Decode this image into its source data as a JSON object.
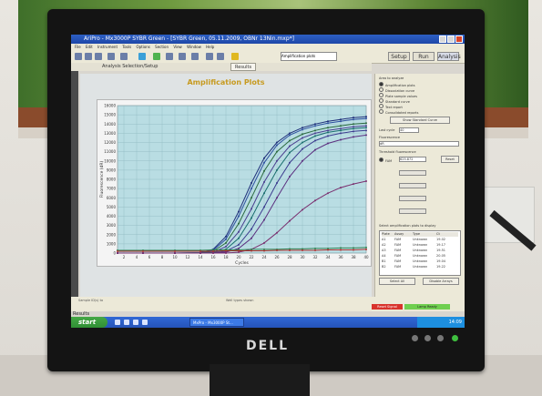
{
  "window": {
    "title": "AriPro - Mx3000P SYBR Green - [SYBR Green, 05.11.2009, OBNr 13Nin.mxp*]",
    "menus": [
      "File",
      "Edit",
      "Instrument",
      "Tools",
      "Options",
      "Section",
      "View",
      "Window",
      "Help"
    ]
  },
  "toolbar": {
    "select_value": "Amplification plots",
    "setup_label": "Setup",
    "run_label": "Run",
    "analysis_label": "Analysis"
  },
  "tabs": [
    {
      "label": "Analysis Selection/Setup"
    },
    {
      "label": "Results"
    }
  ],
  "chart_data": {
    "type": "line",
    "title": "Amplification Plots",
    "xlabel": "Cycles",
    "ylabel": "Fluorescence (dR)",
    "xlim": [
      1,
      40
    ],
    "ylim": [
      0,
      16000
    ],
    "xticks": [
      2,
      4,
      6,
      8,
      10,
      12,
      14,
      16,
      18,
      20,
      22,
      24,
      26,
      28,
      30,
      32,
      34,
      36,
      38,
      40
    ],
    "yticks": [
      0,
      1000,
      2000,
      3000,
      4000,
      5000,
      6000,
      7000,
      8000,
      9000,
      10000,
      11000,
      12000,
      13000,
      14000,
      15000,
      16000
    ],
    "ytick_labels": [
      "0",
      "1000",
      "2000",
      "3000",
      "4000",
      "5000",
      "6000",
      "7000",
      "8000",
      "9000",
      "10000",
      "11000",
      "12000",
      "13000",
      "14000",
      "15000",
      "16000"
    ],
    "grid": true,
    "background": "#b9dde3",
    "series": [
      {
        "color": "#1f2f7a",
        "x": [
          1,
          5,
          10,
          14,
          16,
          18,
          20,
          22,
          24,
          26,
          28,
          30,
          32,
          34,
          36,
          38,
          40
        ],
        "y": [
          0,
          0,
          0,
          50,
          400,
          1800,
          4500,
          7600,
          10300,
          12000,
          13000,
          13600,
          14000,
          14300,
          14500,
          14700,
          14800
        ]
      },
      {
        "color": "#2e4f9f",
        "x": [
          1,
          5,
          10,
          14,
          16,
          18,
          20,
          22,
          24,
          26,
          28,
          30,
          32,
          34,
          36,
          38,
          40
        ],
        "y": [
          0,
          0,
          0,
          30,
          300,
          1500,
          4000,
          7000,
          9800,
          11700,
          12800,
          13400,
          13800,
          14100,
          14300,
          14500,
          14600
        ]
      },
      {
        "color": "#2c6b3f",
        "x": [
          1,
          5,
          10,
          14,
          16,
          18,
          20,
          22,
          24,
          26,
          28,
          30,
          32,
          34,
          36,
          38,
          40
        ],
        "y": [
          0,
          0,
          0,
          20,
          200,
          1100,
          3200,
          6000,
          8900,
          11000,
          12200,
          12900,
          13300,
          13600,
          13800,
          14000,
          14100
        ]
      },
      {
        "color": "#4a3f8f",
        "x": [
          1,
          5,
          10,
          14,
          16,
          18,
          20,
          22,
          24,
          26,
          28,
          30,
          32,
          34,
          36,
          38,
          40
        ],
        "y": [
          0,
          0,
          0,
          10,
          100,
          700,
          2300,
          4800,
          7700,
          10000,
          11600,
          12500,
          13000,
          13300,
          13500,
          13700,
          13800
        ]
      },
      {
        "color": "#1a6e6e",
        "x": [
          1,
          5,
          10,
          14,
          16,
          18,
          20,
          22,
          24,
          26,
          28,
          30,
          32,
          34,
          36,
          38,
          40
        ],
        "y": [
          0,
          0,
          0,
          0,
          50,
          400,
          1600,
          3800,
          6500,
          9000,
          10900,
          12000,
          12700,
          13100,
          13300,
          13500,
          13600
        ]
      },
      {
        "color": "#3c3c8f",
        "x": [
          1,
          5,
          10,
          14,
          16,
          18,
          20,
          22,
          24,
          26,
          28,
          30,
          32,
          34,
          36,
          38,
          40
        ],
        "y": [
          0,
          0,
          0,
          0,
          20,
          200,
          900,
          2600,
          5000,
          7600,
          9800,
          11300,
          12200,
          12700,
          13000,
          13200,
          13300
        ]
      },
      {
        "color": "#5b2f7f",
        "x": [
          1,
          5,
          10,
          14,
          16,
          18,
          20,
          22,
          24,
          26,
          28,
          30,
          32,
          34,
          36,
          38,
          40
        ],
        "y": [
          0,
          0,
          0,
          0,
          0,
          100,
          500,
          1600,
          3600,
          6000,
          8300,
          10000,
          11200,
          11900,
          12300,
          12600,
          12800
        ]
      },
      {
        "color": "#7a2f6f",
        "x": [
          1,
          5,
          10,
          14,
          16,
          18,
          20,
          22,
          24,
          26,
          28,
          30,
          32,
          34,
          36,
          38,
          40
        ],
        "y": [
          0,
          0,
          0,
          0,
          0,
          0,
          100,
          400,
          1100,
          2200,
          3500,
          4700,
          5700,
          6500,
          7100,
          7500,
          7800
        ]
      },
      {
        "color": "#2f7f4f",
        "x": [
          1,
          5,
          10,
          14,
          16,
          18,
          20,
          22,
          24,
          26,
          28,
          30,
          32,
          34,
          36,
          38,
          40
        ],
        "y": [
          300,
          300,
          300,
          300,
          350,
          350,
          350,
          400,
          400,
          400,
          450,
          450,
          500,
          500,
          550,
          550,
          600
        ]
      },
      {
        "color": "#b0302f",
        "x": [
          1,
          5,
          10,
          14,
          16,
          18,
          20,
          22,
          24,
          26,
          28,
          30,
          32,
          34,
          36,
          38,
          40
        ],
        "y": [
          200,
          200,
          200,
          200,
          200,
          250,
          250,
          250,
          250,
          300,
          300,
          300,
          300,
          350,
          350,
          350,
          400
        ]
      }
    ]
  },
  "side_panel": {
    "header": "Area to analyze",
    "options": [
      {
        "label": "Amplification plots",
        "selected": true
      },
      {
        "label": "Dissociation curve",
        "selected": false
      },
      {
        "label": "Plate sample values",
        "selected": false
      },
      {
        "label": "Standard curve",
        "selected": false
      },
      {
        "label": "Text report",
        "selected": false
      },
      {
        "label": "Consolidated reports",
        "selected": false
      }
    ],
    "show_standard_curve": "Show Standard Curve",
    "last_cycle_label": "Last cycle",
    "last_cycle_value": "40",
    "fluorescence_label": "Fluorescence",
    "fluorescence_value": "dR",
    "threshold_header": "Threshold fluorescence",
    "threshold_dye": "FAM",
    "threshold_value": "625.872",
    "reset_label": "Reset",
    "list_header": "Select amplification plots to display",
    "list_columns": [
      "Plate",
      "Assay",
      "Type",
      "Ct"
    ],
    "list_rows": [
      {
        "plate": "A1",
        "assay": "FAM",
        "type": "Unknown",
        "ct": "19.02"
      },
      {
        "plate": "A2",
        "assay": "FAM",
        "type": "Unknown",
        "ct": "19.17"
      },
      {
        "plate": "A3",
        "assay": "FAM",
        "type": "Unknown",
        "ct": "19.51"
      },
      {
        "plate": "A4",
        "assay": "FAM",
        "type": "Unknown",
        "ct": "20.05"
      },
      {
        "plate": "B1",
        "assay": "FAM",
        "type": "Unknown",
        "ct": "19.04"
      },
      {
        "plate": "B2",
        "assay": "FAM",
        "type": "Unknown",
        "ct": "19.22"
      }
    ],
    "select_all": "Select All",
    "disable_arrays": "Disable Arrays"
  },
  "bottom": {
    "sample_left_label": "Sample ID(s) to",
    "sample_right_label": "Well types shown",
    "results_label": "Results",
    "status_red": "Reset Signal",
    "status_green": "Lamp Ready"
  },
  "taskbar": {
    "start_label": "start",
    "task_label": "MxPro - Mx3000P St...",
    "clock": "14:09"
  },
  "monitor": {
    "brand": "DELL"
  }
}
